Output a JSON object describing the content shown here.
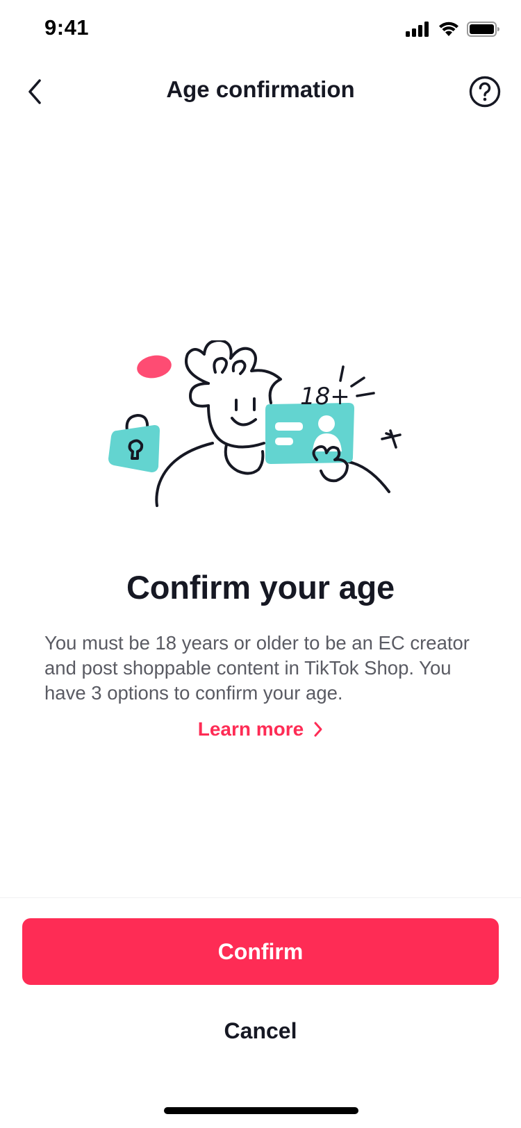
{
  "status_bar": {
    "time": "9:41",
    "icons": [
      "cellular-signal-icon",
      "wifi-icon",
      "battery-icon"
    ]
  },
  "nav": {
    "title": "Age confirmation",
    "back_icon": "chevron-left-icon",
    "help_icon": "question-circle-icon"
  },
  "illustration": {
    "id_label": "18+"
  },
  "content": {
    "heading": "Confirm your age",
    "body": "You must be 18 years or older to be an EC creator and post shoppable content in TikTok Shop. You have 3 options to confirm your age.",
    "learn_more": "Learn more"
  },
  "actions": {
    "confirm_label": "Confirm",
    "cancel_label": "Cancel"
  },
  "colors": {
    "accent": "#fe2c55",
    "teal": "#63d4d0",
    "text_primary": "#161823",
    "text_secondary": "#5a5b63"
  }
}
